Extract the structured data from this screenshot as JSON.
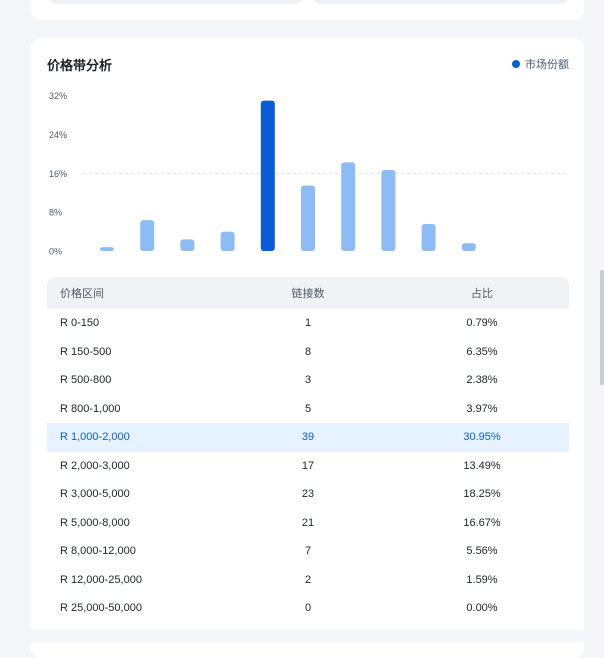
{
  "colors": {
    "accent": "#0b5ed7",
    "bar": "#8bbcf5",
    "bar_highlight": "#0a5cd6",
    "gridline": "#d9dde3",
    "highlight_row_bg": "#e6f2ff"
  },
  "section": {
    "title": "价格带分析",
    "legend_label": "市场份额"
  },
  "table": {
    "headers": [
      "价格区间",
      "链接数",
      "占比"
    ],
    "rows": [
      {
        "range": "R 0-150",
        "count": "1",
        "share": "0.79%",
        "highlight": false
      },
      {
        "range": "R 150-500",
        "count": "8",
        "share": "6.35%",
        "highlight": false
      },
      {
        "range": "R 500-800",
        "count": "3",
        "share": "2.38%",
        "highlight": false
      },
      {
        "range": "R 800-1,000",
        "count": "5",
        "share": "3.97%",
        "highlight": false
      },
      {
        "range": "R 1,000-2,000",
        "count": "39",
        "share": "30.95%",
        "highlight": true
      },
      {
        "range": "R 2,000-3,000",
        "count": "17",
        "share": "13.49%",
        "highlight": false
      },
      {
        "range": "R 3,000-5,000",
        "count": "23",
        "share": "18.25%",
        "highlight": false
      },
      {
        "range": "R 5,000-8,000",
        "count": "21",
        "share": "16.67%",
        "highlight": false
      },
      {
        "range": "R 8,000-12,000",
        "count": "7",
        "share": "5.56%",
        "highlight": false
      },
      {
        "range": "R 12,000-25,000",
        "count": "2",
        "share": "1.59%",
        "highlight": false
      },
      {
        "range": "R 25,000-50,000",
        "count": "0",
        "share": "0.00%",
        "highlight": false
      }
    ]
  },
  "chart_data": {
    "type": "bar",
    "title": "价格带分析",
    "categories": [
      "R 0-150",
      "R 150-500",
      "R 500-800",
      "R 800-1,000",
      "R 1,000-2,000",
      "R 2,000-3,000",
      "R 3,000-5,000",
      "R 5,000-8,000",
      "R 8,000-12,000",
      "R 12,000-25,000"
    ],
    "series": [
      {
        "name": "市场份额",
        "values": [
          0.79,
          6.35,
          2.38,
          3.97,
          30.95,
          13.49,
          18.25,
          16.67,
          5.56,
          1.59
        ]
      }
    ],
    "ylim": [
      0,
      32
    ],
    "yticks": [
      "0%",
      "8%",
      "16%",
      "24%",
      "32%"
    ],
    "ytick_values": [
      0,
      8,
      16,
      24,
      32
    ],
    "reference_line": 16,
    "highlight_index": 4,
    "legend_position": "top-right",
    "grid": false
  }
}
